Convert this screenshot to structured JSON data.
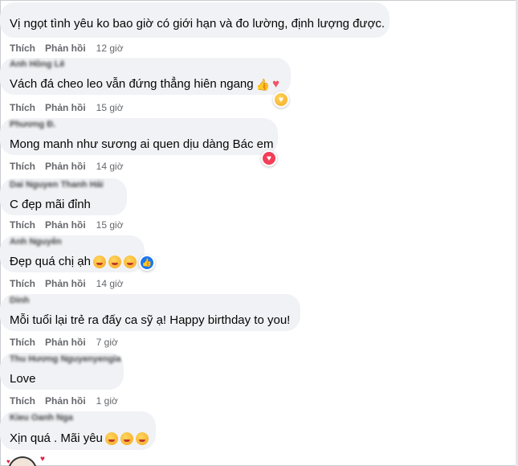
{
  "actions": {
    "like": "Thích",
    "reply": "Phản hồi"
  },
  "comments": [
    {
      "author": "",
      "text": "Vị ngọt tình yêu ko bao giờ có giới hạn và đo lường, định lượng được.",
      "time": "12 giờ"
    },
    {
      "author": "Anh Hồng Lê",
      "text": "Vách đá cheo leo vẫn đứng thẳng hiên ngang",
      "time": "15 giờ"
    },
    {
      "author": "Phương Đ.",
      "text": "Mong manh như sương ai quen dịu dàng Bác em",
      "time": "14 giờ"
    },
    {
      "author": "Dai Nguyen Thanh Hải",
      "text": "C đẹp mãi đỉnh",
      "time": "15 giờ"
    },
    {
      "author": "Anh Nguyễn",
      "text": "Đẹp quá chị ạh",
      "time": "14 giờ"
    },
    {
      "author": "Dinh",
      "text": "Mỗi tuổi lại trẻ ra đấy ca sỹ ạ! Happy birthday to you!",
      "time": "7 giờ"
    },
    {
      "author": "Thu Hương Nguyenyengia",
      "text": "Love",
      "time": "1 giờ"
    },
    {
      "author": "Kieu Oanh Nga",
      "text": "Xịn quá . Mãi yêu",
      "time": ""
    }
  ],
  "colors": {
    "bubble": "#f0f2f5",
    "meta": "#65676b",
    "love": "#f33e58",
    "like": "#1877f2"
  },
  "icons": [
    "thumbs-up-emoji",
    "heart-emoji",
    "love-reaction",
    "care-reaction",
    "like-reaction",
    "smiling-hearts-emoji",
    "kissing-heart-emoji"
  ]
}
